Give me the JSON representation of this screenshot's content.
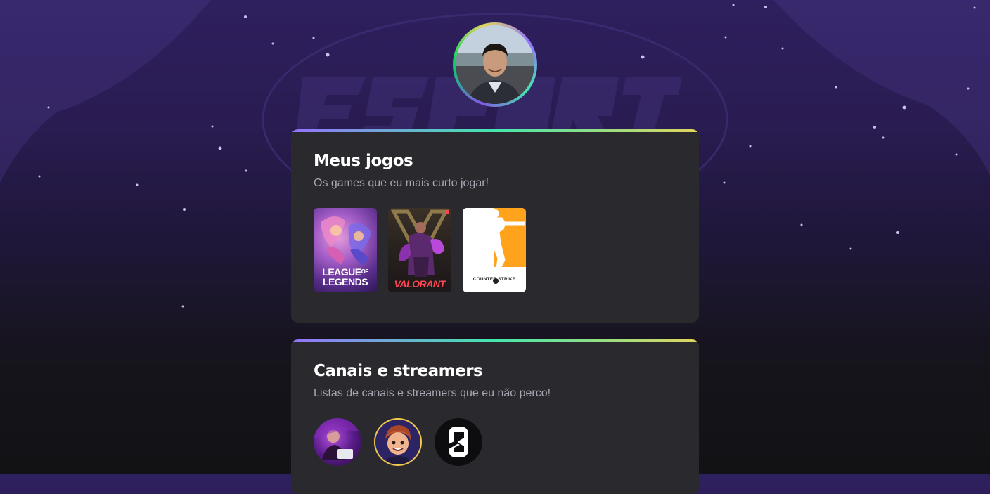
{
  "profile": {
    "avatar_alt": "profile-photo"
  },
  "games_section": {
    "title": "Meus jogos",
    "subtitle": "Os games que eu mais curto jogar!",
    "games": [
      {
        "label": "LEAGUE OF LEGENDS",
        "line1": "LEAGUE",
        "of": "OF",
        "line2": "LEGENDS"
      },
      {
        "label": "VALORANT"
      },
      {
        "label": "COUNTER STRIKE"
      }
    ]
  },
  "streamers_section": {
    "title": "Canais e streamers",
    "subtitle": "Listas de canais e streamers que eu não perco!",
    "streamers": [
      {
        "icon": "streamer-1-avatar"
      },
      {
        "icon": "streamer-2-avatar"
      },
      {
        "icon": "streamer-3-avatar"
      }
    ]
  },
  "colors": {
    "accent_gradient": [
      "#9572fc",
      "#43e7ad",
      "#e1d55d"
    ],
    "card_bg": "#29292e",
    "cs_orange": "#ffa31c"
  }
}
